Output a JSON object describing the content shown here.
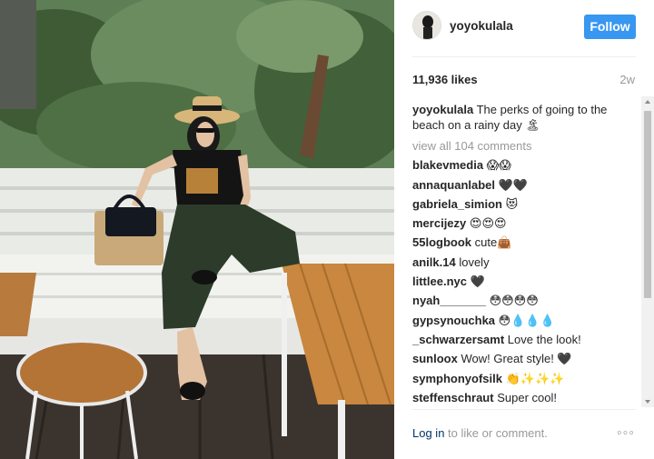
{
  "post": {
    "username": "yoyokulala",
    "follow_label": "Follow",
    "likes": "11,936 likes",
    "time_ago": "2w"
  },
  "caption": {
    "username": "yoyokulala",
    "text": "The perks of going to the beach on a rainy day 🏝"
  },
  "view_all": "view all 104 comments",
  "comments": [
    {
      "username": "blakevmedia",
      "text": "😱😱"
    },
    {
      "username": "annaquanlabel",
      "text": "🖤🖤"
    },
    {
      "username": "gabriela_simion",
      "text": "😻"
    },
    {
      "username": "mercijezy",
      "text": "😍😍😍"
    },
    {
      "username": "55logbook",
      "text": "cute👜"
    },
    {
      "username": "anilk.14",
      "text": "lovely"
    },
    {
      "username": "littlee.nyc",
      "text": "🖤"
    },
    {
      "username": "nyah_______",
      "text": "😳😳😳😳"
    },
    {
      "username": "gypsynouchka",
      "text": "😳💧💧💧"
    },
    {
      "username": "_schwarzersamt",
      "text": "Love the look!"
    },
    {
      "username": "sunloox",
      "text": "Wow! Great style! 🖤"
    },
    {
      "username": "symphonyofsilk",
      "text": "👏✨✨✨"
    },
    {
      "username": "steffenschraut",
      "text": "Super cool!"
    }
  ],
  "footer": {
    "login_link": "Log in",
    "login_rest": " to like or comment.",
    "more_icon": "more-horizontal-icon"
  }
}
